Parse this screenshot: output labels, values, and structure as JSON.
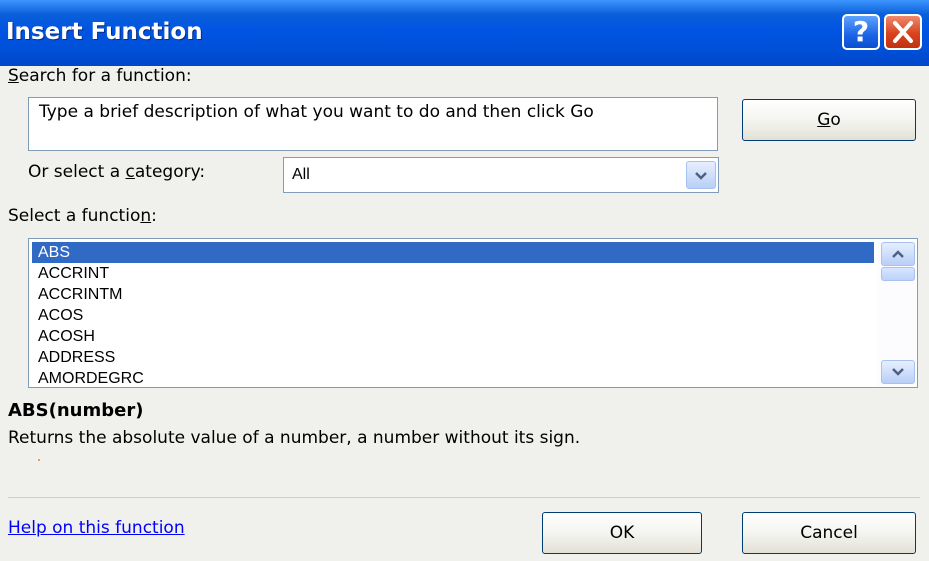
{
  "window": {
    "title": "Insert Function",
    "help_glyph": "?",
    "close_glyph": "✕"
  },
  "search": {
    "label_pre": "",
    "label_accel": "S",
    "label_post": "earch for a function:",
    "value": "Type a brief description of what you want to do and then click Go",
    "go_accel": "G",
    "go_post": "o"
  },
  "category": {
    "label_pre": "Or select a ",
    "label_accel": "c",
    "label_post": "ategory:",
    "selected": "All"
  },
  "functions": {
    "label_pre": "Select a functio",
    "label_accel": "n",
    "label_post": ":",
    "items": [
      "ABS",
      "ACCRINT",
      "ACCRINTM",
      "ACOS",
      "ACOSH",
      "ADDRESS",
      "AMORDEGRC"
    ],
    "selected": "ABS"
  },
  "details": {
    "signature": "ABS(number)",
    "description": "Returns the absolute value of a number, a number without its sign."
  },
  "footer": {
    "help_link": "Help on this function",
    "ok": "OK",
    "cancel": "Cancel"
  },
  "icons": {
    "help": "help-icon",
    "close": "close-icon",
    "dropdown": "chevron-down-icon",
    "scroll_up": "chevron-up-icon",
    "scroll_down": "chevron-down-icon"
  },
  "colors": {
    "titlebar": "#0054e3",
    "selection": "#316ac5",
    "link": "#0000ff",
    "close_button": "#d9431e"
  }
}
